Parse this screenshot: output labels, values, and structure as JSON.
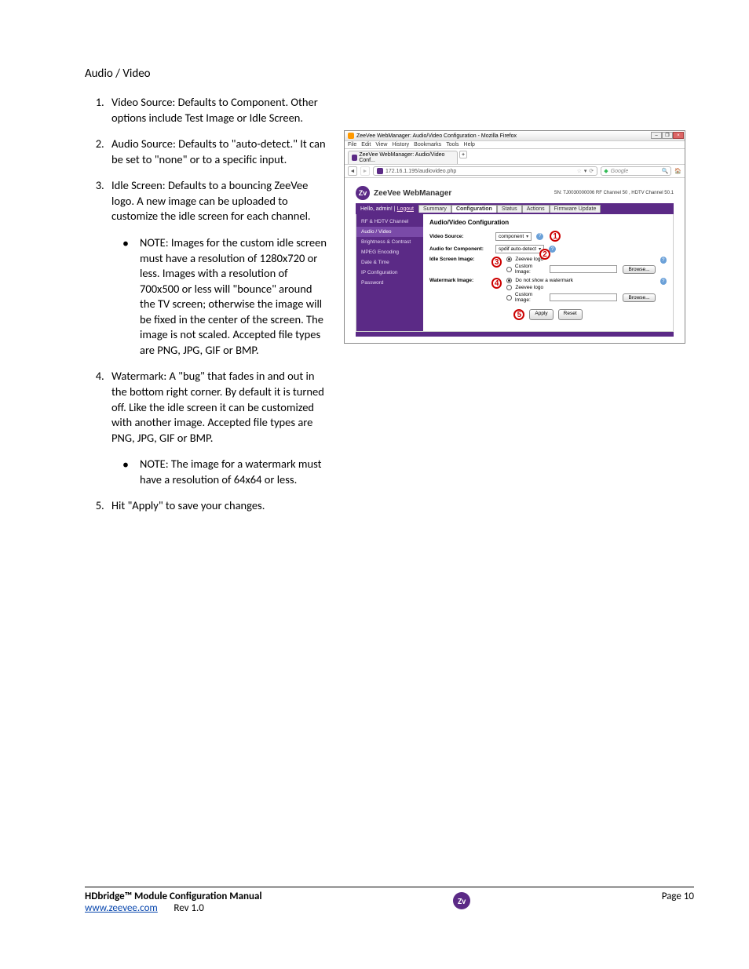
{
  "heading": "Audio / Video",
  "items": [
    {
      "text": "Video Source: Defaults to Component. Other options include Test Image or Idle Screen."
    },
    {
      "text": "Audio Source: Defaults to \"auto-detect.\" It can be set to \"none\" or to a specific input."
    },
    {
      "text": "Idle Screen: Defaults to a bouncing ZeeVee logo. A new image can be uploaded to customize the idle screen for each channel.",
      "sub": [
        "NOTE: Images for the custom idle screen must have a resolution of 1280x720 or less. Images with a resolution of 700x500 or less will \"bounce\" around the TV screen; otherwise the image will be fixed in the center of the screen. The image is not scaled.  Accepted file types are PNG, JPG, GIF or BMP."
      ]
    },
    {
      "text": "Watermark: A \"bug\" that fades in and out in the bottom right corner. By default it is turned off. Like the idle screen it can be customized with another image. Accepted file types are PNG, JPG, GIF or BMP.",
      "sub": [
        "NOTE: The image for a watermark must have a resolution of 64x64 or less."
      ]
    },
    {
      "text": "Hit \"Apply\" to save your changes."
    }
  ],
  "browser": {
    "window_title": "ZeeVee WebManager: Audio/Video Configuration - Mozilla Firefox",
    "menu": [
      "File",
      "Edit",
      "View",
      "History",
      "Bookmarks",
      "Tools",
      "Help"
    ],
    "tab_title": "ZeeVee WebManager: Audio/Video Conf...",
    "url": "172.16.1.195/audiovideo.php",
    "search_placeholder": "Google"
  },
  "zv": {
    "brand": "ZeeVee WebManager",
    "info": "SN: TJ0030000006    RF Channel 50 , HDTV Channel 50.1",
    "hello_prefix": "Hello, admin! | ",
    "logout": "Logout",
    "tabs": [
      "Summary",
      "Configuration",
      "Status",
      "Actions",
      "Firmware Update"
    ],
    "active_tab": 1,
    "sidebar": [
      "RF & HDTV Channel",
      "Audio / Video",
      "Brightness & Contrast",
      "MPEG Encoding",
      "Date & Time",
      "IP Configuration",
      "Password"
    ],
    "active_side": 1,
    "panel_title": "Audio/Video Configuration",
    "rows": {
      "video_source": {
        "label": "Video Source:",
        "value": "component"
      },
      "audio_component": {
        "label": "Audio for Component:",
        "value": "spdif auto-detect"
      },
      "idle": {
        "label": "Idle Screen Image:",
        "options": [
          "Zeevee logo",
          "Custom Image:"
        ],
        "browse": "Browse..."
      },
      "watermark": {
        "label": "Watermark Image:",
        "options": [
          "Do not show a watermark",
          "Zeevee logo",
          "Custom Image:"
        ],
        "browse": "Browse..."
      }
    },
    "buttons": {
      "apply": "Apply",
      "reset": "Reset"
    }
  },
  "footer": {
    "title": "HDbridge™ Module Configuration Manual",
    "link": "www.zeevee.com",
    "rev": "Rev 1.0",
    "page": "Page 10"
  }
}
